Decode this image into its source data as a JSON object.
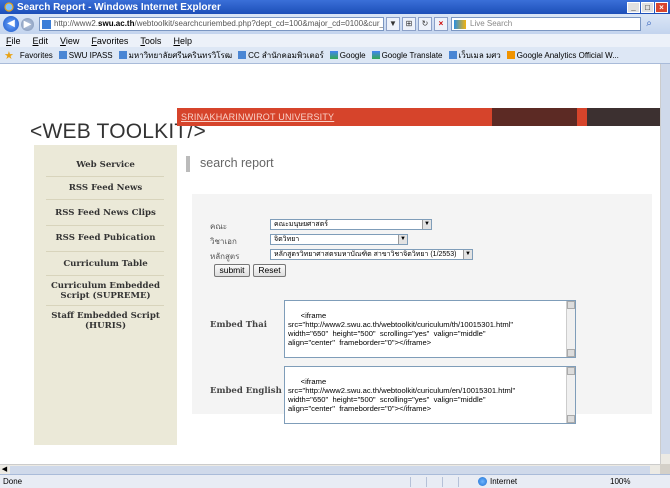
{
  "window": {
    "title": "Search Report - Windows Internet Explorer"
  },
  "addressbar": {
    "url_prefix": "http://www2.",
    "url_domain": "swu.ac.th",
    "url_suffix": "/webtoolkit/searchcuriembed.php?dept_cd=100&major_cd=0100&cur_cd=10015",
    "search_placeholder": "Live Search"
  },
  "menubar": {
    "items": [
      "File",
      "Edit",
      "View",
      "Favorites",
      "Tools",
      "Help"
    ]
  },
  "favorites": {
    "label": "Favorites",
    "items": [
      "SWU IPASS",
      "มหาวิทยาลัยศรีนครินทรวิโรฒ",
      "CC สำนักคอมพิวเตอร์",
      "Google",
      "Google Translate",
      "เว็บเมล มศว",
      "Google Analytics Official W..."
    ]
  },
  "page": {
    "logo": "<WEB TOOLKIT/>",
    "university": "SRINAKHARINWIROT UNIVERSITY",
    "heading": "search report",
    "sidebar": [
      "Web Service",
      "RSS Feed News",
      "RSS Feed News Clips",
      "RSS Feed Pubication",
      "Curriculum Table",
      "Curriculum Embedded Script (SUPREME)",
      "Staff Embedded Script (HURIS)"
    ],
    "form": {
      "faculty_label": "คณะ",
      "faculty_value": "คณะมนุษยศาสตร์",
      "major_label": "วิชาเอก",
      "major_value": "จิตวิทยา",
      "curriculum_label": "หลักสูตร",
      "curriculum_value": "หลักสูตรวิทยาศาสตรมหาบัณฑิต สาขาวิชาจิตวิทยา (1/2553)",
      "submit_label": "submit",
      "reset_label": "Reset",
      "embed_thai_label": "Embed Thai",
      "embed_thai_code": "<iframe\nsrc=\"http://www2.swu.ac.th/webtoolkit/curiculum/th/10015301.html\"\nwidth=\"650\"  height=\"500\"  scrolling=\"yes\"  valign=\"middle\"\nalign=\"center\"  frameborder=\"0\"></iframe>",
      "embed_english_label": "Embed English",
      "embed_english_code": "<iframe\nsrc=\"http://www2.swu.ac.th/webtoolkit/curiculum/en/10015301.html\"\nwidth=\"650\"  height=\"500\"  scrolling=\"yes\"  valign=\"middle\"\nalign=\"center\"  frameborder=\"0\"></iframe>"
    }
  },
  "statusbar": {
    "status": "Done",
    "zone": "Internet",
    "zoom": "100%"
  }
}
